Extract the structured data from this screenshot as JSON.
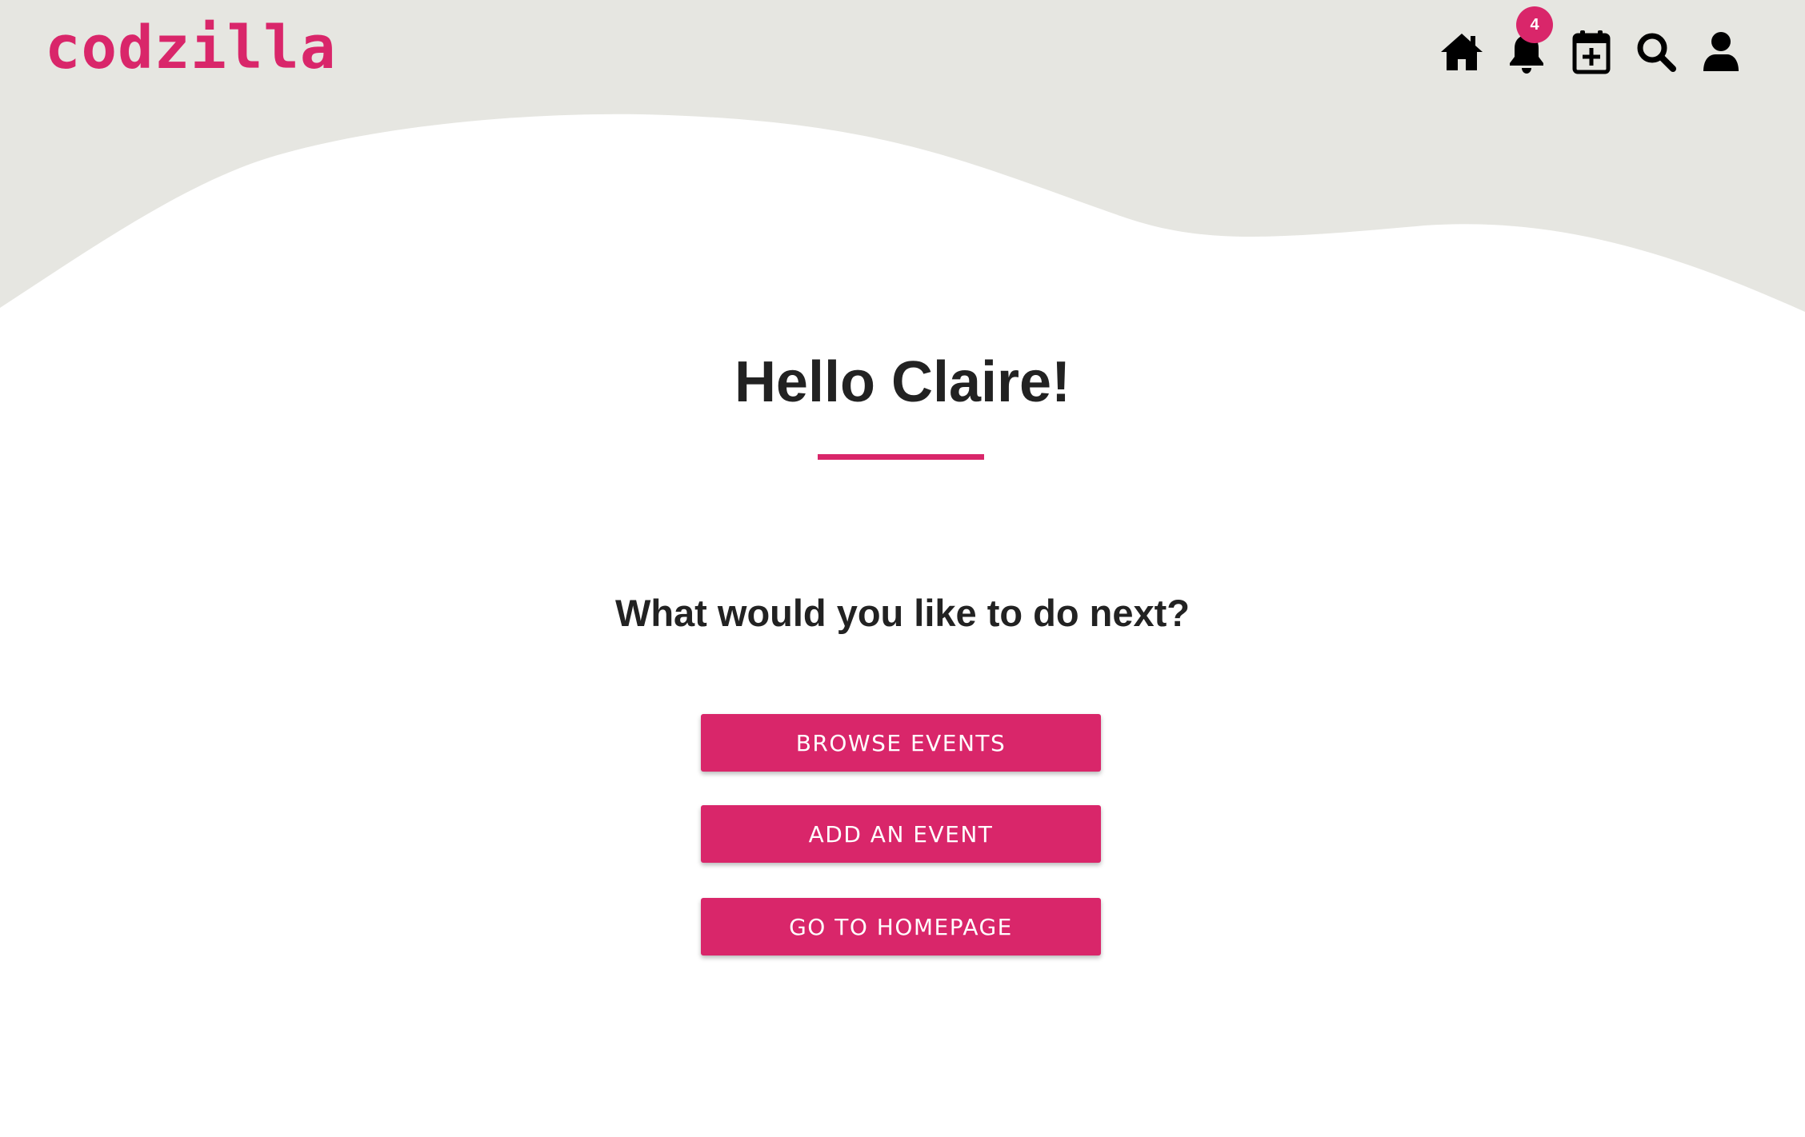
{
  "brand": {
    "logo_text": "codzilla"
  },
  "nav": {
    "items": [
      {
        "icon": "home-icon"
      },
      {
        "icon": "bell-icon",
        "badge": "4"
      },
      {
        "icon": "calendar-plus-icon"
      },
      {
        "icon": "search-icon"
      },
      {
        "icon": "user-icon"
      }
    ]
  },
  "main": {
    "greeting": "Hello Claire!",
    "prompt": "What would you like to do next?",
    "actions": [
      {
        "label": "BROWSE EVENTS"
      },
      {
        "label": "ADD AN EVENT"
      },
      {
        "label": "GO TO HOMEPAGE"
      }
    ]
  },
  "colors": {
    "accent": "#d9266a",
    "header_bg": "#e6e6e1",
    "text": "#222222"
  }
}
